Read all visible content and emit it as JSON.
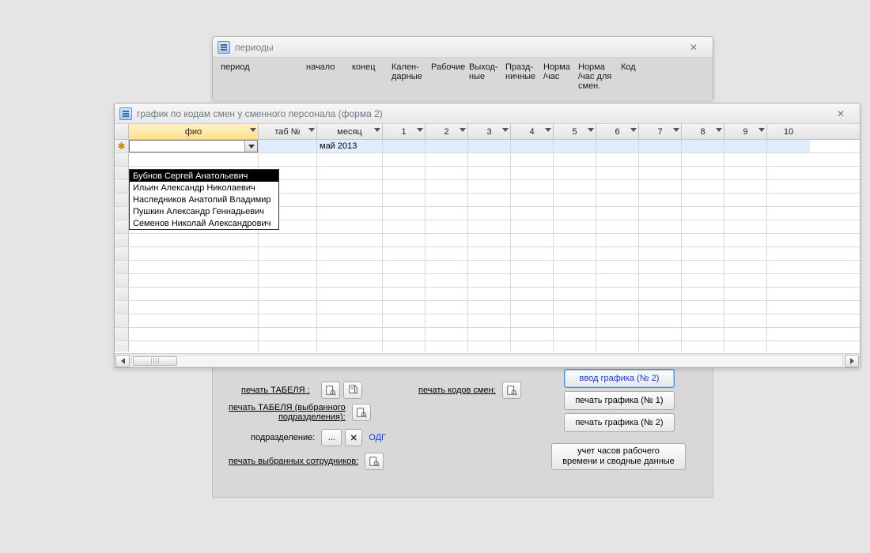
{
  "periods_window": {
    "title": "периоды",
    "columns": [
      "период",
      "начало",
      "конец",
      "Кален-\nдарные",
      "Рабочие",
      "Выход-\nные",
      "Празд-\nничные",
      "Норма\n/час",
      "Норма\n/час для\nсмен.",
      "Код"
    ]
  },
  "grid_window": {
    "title": "график по кодам смен у сменного персонала (форма 2)",
    "columns": {
      "fio": "фио",
      "tabno": "таб №",
      "month": "месяц",
      "days": [
        "1",
        "2",
        "3",
        "4",
        "5",
        "6",
        "7",
        "8",
        "9",
        "10"
      ]
    },
    "row1_month": "май 2013",
    "dropdown_options": [
      "Бубнов Сергей Анатольевич",
      "Ильин Александр Николаевич",
      "Наследников Анатолий Владимир",
      "Пушкин Александр Геннадьевич",
      "Семенов Николай Александрович"
    ]
  },
  "bottom": {
    "print_tabel": "печать ТАБЕЛЯ :",
    "print_codes": "печать кодов смен:",
    "print_tabel_dept": "печать ТАБЕЛЯ (выбранного\nподразделения):",
    "dept_label": "подразделение:",
    "dept_value": "ОДГ",
    "dots": "...",
    "x": "✕",
    "print_selected": "печать выбранных сотрудников:",
    "btn_input2": "ввод графика (№ 2)",
    "btn_print1": "печать графика (№ 1)",
    "btn_print2": "печать графика (№ 2)",
    "btn_hours": "учет часов рабочего\nвремени и сводные данные"
  }
}
